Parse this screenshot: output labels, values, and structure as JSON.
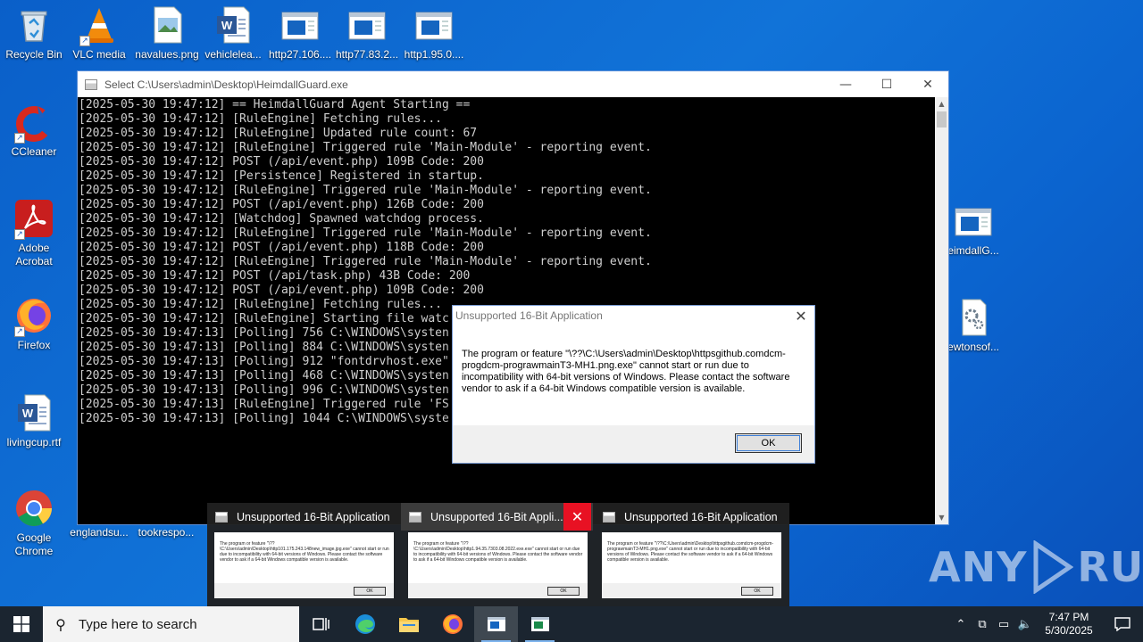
{
  "desktop": {
    "icons_left": [
      {
        "label": "Recycle Bin"
      },
      {
        "label": "VLC media"
      },
      {
        "label": "navalues.png"
      },
      {
        "label": "vehiclelea..."
      },
      {
        "label": "http27.106...."
      },
      {
        "label": "http77.83.2..."
      },
      {
        "label": "http1.95.0...."
      },
      {
        "label": "CCleaner"
      },
      {
        "label": "Adobe Acrobat"
      },
      {
        "label": "Firefox"
      },
      {
        "label": "livingcup.rtf"
      },
      {
        "label": "Google Chrome"
      },
      {
        "label": "englandsu..."
      },
      {
        "label": "tookrespo..."
      }
    ],
    "icons_right": [
      {
        "label": "eimdallG..."
      },
      {
        "label": "ewtonsof..."
      }
    ]
  },
  "console": {
    "title": "Select C:\\Users\\admin\\Desktop\\HeimdallGuard.exe",
    "controls": {
      "minimize": "—",
      "maximize": "☐",
      "close": "✕"
    },
    "lines": [
      "[2025-05-30 19:47:12] == HeimdallGuard Agent Starting ==",
      "[2025-05-30 19:47:12] [RuleEngine] Fetching rules...",
      "[2025-05-30 19:47:12] [RuleEngine] Updated rule count: 67",
      "[2025-05-30 19:47:12] [RuleEngine] Triggered rule 'Main-Module' - reporting event.",
      "[2025-05-30 19:47:12] POST (/api/event.php) 109B Code: 200",
      "[2025-05-30 19:47:12] [Persistence] Registered in startup.",
      "[2025-05-30 19:47:12] [RuleEngine] Triggered rule 'Main-Module' - reporting event.",
      "[2025-05-30 19:47:12] POST (/api/event.php) 126B Code: 200",
      "[2025-05-30 19:47:12] [Watchdog] Spawned watchdog process.",
      "[2025-05-30 19:47:12] [RuleEngine] Triggered rule 'Main-Module' - reporting event.",
      "[2025-05-30 19:47:12] POST (/api/event.php) 118B Code: 200",
      "[2025-05-30 19:47:12] [RuleEngine] Triggered rule 'Main-Module' - reporting event.",
      "[2025-05-30 19:47:12] POST (/api/task.php) 43B Code: 200",
      "[2025-05-30 19:47:12] POST (/api/event.php) 109B Code: 200",
      "[2025-05-30 19:47:12] [RuleEngine] Fetching rules...",
      "[2025-05-30 19:47:12] [RuleEngine] Starting file watc",
      "[2025-05-30 19:47:13] [Polling] 756 C:\\WINDOWS\\systen",
      "[2025-05-30 19:47:13] [Polling] 884 C:\\WINDOWS\\systen",
      "[2025-05-30 19:47:13] [Polling] 912 \"fontdrvhost.exe\"",
      "[2025-05-30 19:47:13] [Polling] 468 C:\\WINDOWS\\systen",
      "[2025-05-30 19:47:13] [Polling] 996 C:\\WINDOWS\\systen",
      "[2025-05-30 19:47:13] [RuleEngine] Triggered rule 'FS",
      "[2025-05-30 19:47:13] [Polling] 1044 C:\\WINDOWS\\syste"
    ]
  },
  "dialog": {
    "title": "Unsupported 16-Bit Application",
    "close": "✕",
    "message": "The program or feature \"\\??\\C:\\Users\\admin\\Desktop\\httpsgithub.comdcm-progdcm-prograwmainT3-MH1.png.exe\" cannot start or run due to incompatibility with 64-bit versions of Windows. Please contact the software vendor to ask if a 64-bit Windows compatible version is available.",
    "ok": "OK"
  },
  "previews": [
    {
      "title": "Unsupported 16-Bit Application",
      "message": "The program or feature \"\\??\\C:\\Users\\admin\\Desktop\\http101.175.243.148new_image.jpg.exe\" cannot start or run due to incompatibility with 64-bit versions of Windows. Please contact the software vendor to ask if a 64-bit Windows compatible version is available.",
      "ok": "OK"
    },
    {
      "title": "Unsupported 16-Bit Appli...",
      "message": "The program or feature \"\\??\\C:\\Users\\admin\\Desktop\\http1.94.35.7303.08.2022.exe.exe\" cannot start or run due to incompatibility with 64-bit versions of Windows. Please contact the software vendor to ask if a 64-bit Windows compatible version is available.",
      "ok": "OK",
      "close": "✕"
    },
    {
      "title": "Unsupported 16-Bit Application",
      "message": "The program or feature \"\\??\\C:\\Users\\admin\\Desktop\\httpsgithub.comdcm-progdcm-prograwmainT3-MH1.png.exe\" cannot start or run due to incompatibility with 64-bit versions of Windows. Please contact the software vendor to ask if a 64-bit Windows compatible version is available.",
      "ok": "OK"
    }
  ],
  "watermark": {
    "left": "ANY",
    "right": "RUN"
  },
  "taskbar": {
    "search_placeholder": "Type here to search",
    "time": "7:47 PM",
    "date": "5/30/2025"
  }
}
